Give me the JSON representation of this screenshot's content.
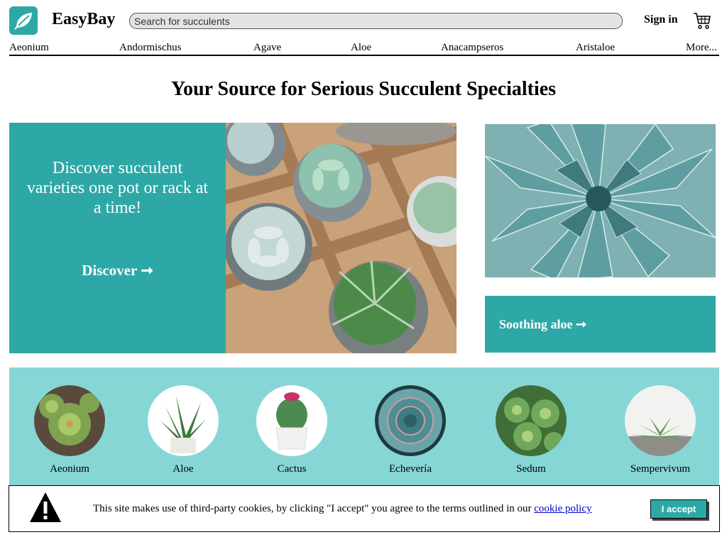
{
  "header": {
    "brand": "EasyBay",
    "search_placeholder": "Search for succulents",
    "signin": "Sign in"
  },
  "nav": [
    {
      "label": "Aeonium"
    },
    {
      "label": "Andormischus"
    },
    {
      "label": "Agave"
    },
    {
      "label": "Aloe"
    },
    {
      "label": "Anacampseros"
    },
    {
      "label": "Aristaloe"
    },
    {
      "label": "More..."
    }
  ],
  "page_title": "Your Source for Serious Succulent Specialties",
  "hero": {
    "text": "Discover succulent varieties one pot or rack at a time!",
    "link": "Discover ➞"
  },
  "aloe_promo": {
    "link": "Soothing aloe ➞"
  },
  "categories": [
    {
      "label": "Aeonium"
    },
    {
      "label": "Aloe"
    },
    {
      "label": "Cactus"
    },
    {
      "label": "Echevería"
    },
    {
      "label": "Sedum"
    },
    {
      "label": "Sempervivum"
    }
  ],
  "cookie": {
    "text": "This site makes use of third-party cookies, by clicking \"I accept\" you agree to the terms outlined in our ",
    "link": "cookie policy",
    "accept": "I accept"
  },
  "colors": {
    "accent": "#2ea8a7",
    "category_band": "#87d6d6"
  }
}
